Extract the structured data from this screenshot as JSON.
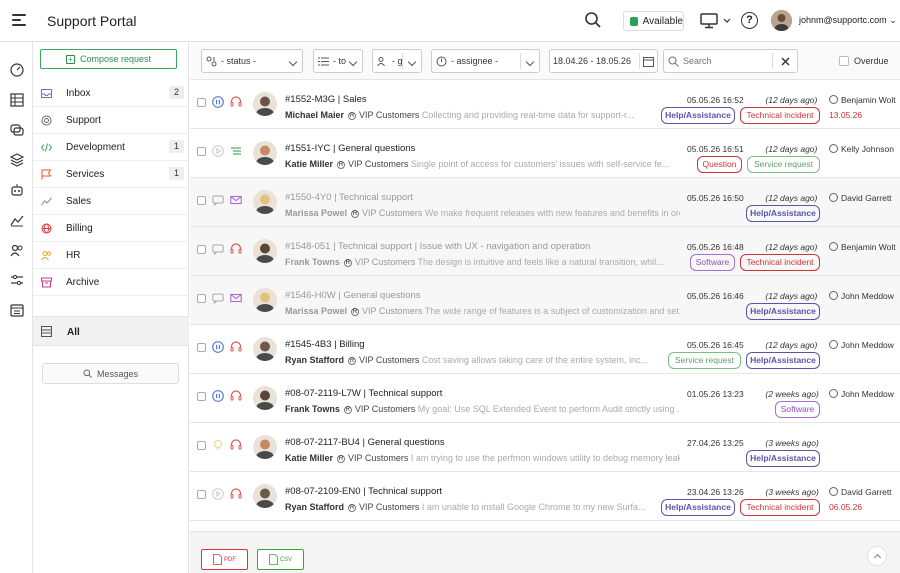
{
  "app": {
    "title": "Support Portal"
  },
  "topbar": {
    "availability": "Available",
    "user_email": "johnm@supportc.com",
    "help_glyph": "?"
  },
  "sidebar": {
    "compose_label": "Compose request",
    "items": [
      {
        "label": "Inbox",
        "count": "2",
        "icon": "inbox-icon",
        "color": "#6a78b8"
      },
      {
        "label": "Support",
        "count": "",
        "icon": "support-icon",
        "color": "#666666"
      },
      {
        "label": "Development",
        "count": "1",
        "icon": "code-icon",
        "color": "#43a35c"
      },
      {
        "label": "Services",
        "count": "1",
        "icon": "flag-icon",
        "color": "#e45a2a"
      },
      {
        "label": "Sales",
        "count": "",
        "icon": "chart-icon",
        "color": "#7a86c9"
      },
      {
        "label": "Billing",
        "count": "",
        "icon": "globe-icon",
        "color": "#e03b3b"
      },
      {
        "label": "HR",
        "count": "",
        "icon": "people-icon",
        "color": "#e8a23a"
      },
      {
        "label": "Archive",
        "count": "",
        "icon": "archive-icon",
        "color": "#c43b86"
      }
    ],
    "all_label": "All",
    "messages_label": "Messages"
  },
  "filters": {
    "status": "- status -",
    "to": "- to",
    "group": "- g",
    "assignee": "- assignee -",
    "date_range": "18.04.26 - 18.05.26",
    "search_placeholder": "Search",
    "overdue_label": "Overdue"
  },
  "tickets": [
    {
      "title": "#1552-M3G | Sales",
      "name": "Michael Maier",
      "tier": "VIP Customers",
      "desc": "Collecting and providing real-time data for support-r...",
      "date": "05.05.26 16:52",
      "ago": "(12 days ago)",
      "agent": "Benjamin Wolt",
      "due": "13.05.26",
      "tags": [
        {
          "label": "Help/Assistance",
          "kind": "help"
        },
        {
          "label": "Technical incident",
          "kind": "incident"
        }
      ],
      "dim": false,
      "avatar": "#6b5446",
      "st1": "pause",
      "st2": "headset-red"
    },
    {
      "title": "#1551-IYC | General questions",
      "name": "Katie Miller",
      "tier": "VIP Customers",
      "desc": "Single point of access for customers' issues with self-service fe...",
      "date": "05.05.26 16:51",
      "ago": "(12 days ago)",
      "agent": "Kelly Johnson",
      "due": "",
      "tags": [
        {
          "label": "Question",
          "kind": "question"
        },
        {
          "label": "Service request",
          "kind": "servreq"
        }
      ],
      "dim": false,
      "avatar": "#c98a63",
      "st1": "play",
      "st2": "list-green"
    },
    {
      "title": "#1550-4Y0 | Technical support",
      "name": "Marissa Powel",
      "tier": "VIP Customers",
      "desc": "We make frequent releases with new features and benefits in ord...",
      "date": "05.05.26 16:50",
      "ago": "(12 days ago)",
      "agent": "David Garrett",
      "due": "",
      "tags": [
        {
          "label": "Help/Assistance",
          "kind": "help"
        }
      ],
      "dim": true,
      "avatar": "#e2c27e",
      "st1": "chat",
      "st2": "mail-purple"
    },
    {
      "title": "#1548-051 | Technical support  | Issue with UX - navigation and operation",
      "name": "Frank Towns",
      "tier": "VIP Customers",
      "desc": "The design is intuitive and feels like a natural transition, whil...",
      "date": "05.05.26 16:48",
      "ago": "(12 days ago)",
      "agent": "Benjamin Wolt",
      "due": "",
      "tags": [
        {
          "label": "Software",
          "kind": "software"
        },
        {
          "label": "Technical incident",
          "kind": "incident"
        }
      ],
      "dim": true,
      "avatar": "#5a4638",
      "st1": "chat",
      "st2": "headset-red"
    },
    {
      "title": "#1546-H0W | General questions",
      "name": "Marissa Powel",
      "tier": "VIP Customers",
      "desc": "The wide range of features is a subject of customization and set...",
      "date": "05.05.26 16:46",
      "ago": "(12 days ago)",
      "agent": "John Meddow",
      "due": "",
      "tags": [
        {
          "label": "Help/Assistance",
          "kind": "help"
        }
      ],
      "dim": true,
      "avatar": "#e2c27e",
      "st1": "chat",
      "st2": "mail-purple"
    },
    {
      "title": "#1545-4B3 | Billing",
      "name": "Ryan Stafford",
      "tier": "VIP Customers",
      "desc": "Cost saving allows taking care of the entire system, inc...",
      "date": "05.05.26 16:45",
      "ago": "(12 days ago)",
      "agent": "John Meddow",
      "due": "",
      "tags": [
        {
          "label": "Service request",
          "kind": "servreq"
        },
        {
          "label": "Help/Assistance",
          "kind": "help"
        }
      ],
      "dim": false,
      "avatar": "#6a5a4a",
      "st1": "pause",
      "st2": "headset-red"
    },
    {
      "title": "#08-07-2119-L7W | Technical support",
      "name": "Frank Towns",
      "tier": "VIP Customers",
      "desc": "My goal: Use SQL Extended Event to perform Audit strictly using ...",
      "date": "01.05.26 13:23",
      "ago": "(2 weeks ago)",
      "agent": "John Meddow",
      "due": "",
      "tags": [
        {
          "label": "Software",
          "kind": "software"
        }
      ],
      "dim": false,
      "avatar": "#5a4638",
      "st1": "pause",
      "st2": "headset-red"
    },
    {
      "title": "#08-07-2117-BU4 | General questions",
      "name": "Katie Miller",
      "tier": "VIP Customers",
      "desc": "I am trying to use the perfmon windows utility to debug memory leaks in a process...",
      "date": "27.04.26 13:25",
      "ago": "(3 weeks ago)",
      "agent": "",
      "due": "",
      "tags": [
        {
          "label": "Help/Assistance",
          "kind": "help"
        }
      ],
      "dim": false,
      "avatar": "#c98a63",
      "st1": "bulb",
      "st2": "headset-red"
    },
    {
      "title": "#08-07-2109-EN0 | Technical support",
      "name": "Ryan Stafford",
      "tier": "VIP Customers",
      "desc": "I am unable to install Google Chrome to my new Surfa...",
      "date": "23.04.26 13:26",
      "ago": "(3 weeks ago)",
      "agent": "David Garrett",
      "due": "06.05.26",
      "tags": [
        {
          "label": "Help/Assistance",
          "kind": "help"
        },
        {
          "label": "Technical incident",
          "kind": "incident"
        }
      ],
      "dim": false,
      "avatar": "#6a5a4a",
      "st1": "play",
      "st2": "headset-red"
    }
  ],
  "export": {
    "pdf": "PDF",
    "csv": "CSV"
  }
}
